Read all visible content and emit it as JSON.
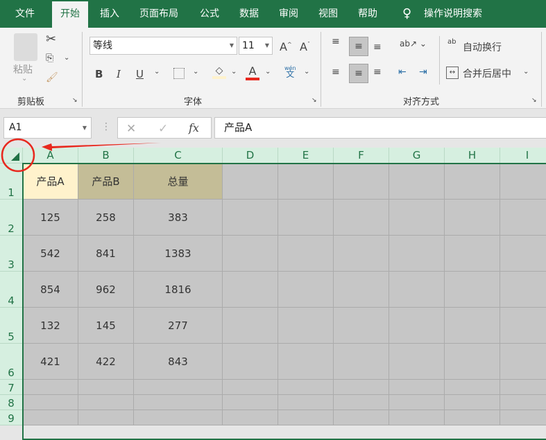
{
  "tabs": [
    "文件",
    "开始",
    "插入",
    "页面布局",
    "公式",
    "数据",
    "审阅",
    "视图",
    "帮助"
  ],
  "search": "操作说明搜索",
  "clipboard": {
    "paste": "粘贴",
    "label": "剪贴板"
  },
  "font": {
    "name": "等线",
    "size": "11",
    "label": "字体",
    "bold": "B",
    "italic": "I",
    "underline": "U",
    "font_color_glyph": "A",
    "phonetic_top": "wén",
    "phonetic_bottom": "文"
  },
  "align": {
    "wrap": "自动换行",
    "merge": "合并后居中",
    "label": "对齐方式",
    "wrap_icon": "ab"
  },
  "formula": {
    "name_box": "A1",
    "content": "产品A",
    "fx": "fx"
  },
  "columns": [
    "A",
    "B",
    "C",
    "D",
    "E",
    "F",
    "G",
    "H",
    "I"
  ],
  "rows": [
    "1",
    "2",
    "3",
    "4",
    "5",
    "6",
    "7",
    "8",
    "9"
  ],
  "cells": [
    [
      "产品A",
      "产品B",
      "总量"
    ],
    [
      "125",
      "258",
      "383"
    ],
    [
      "542",
      "841",
      "1383"
    ],
    [
      "854",
      "962",
      "1816"
    ],
    [
      "132",
      "145",
      "277"
    ],
    [
      "421",
      "422",
      "843"
    ]
  ],
  "colors": {
    "brand": "#217346",
    "a1_fill": "#fff2cc",
    "header_fill": "#c4bd97",
    "range_fill": "#c6c6c6",
    "annotation": "#e8281e"
  }
}
